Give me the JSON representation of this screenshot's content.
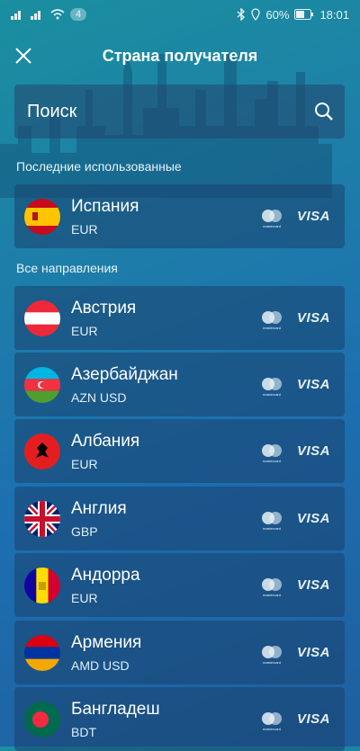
{
  "statusbar": {
    "notif_count": "4",
    "battery": "60%",
    "time": "18:01"
  },
  "header": {
    "title": "Страна получателя"
  },
  "search": {
    "placeholder": "Поиск"
  },
  "sections": {
    "recent": "Последние использованные",
    "all": "Все направления"
  },
  "card_labels": {
    "mastercard": "mastercard",
    "visa": "VISA"
  },
  "recent": [
    {
      "name": "Испания",
      "currency": "EUR",
      "flag": "spain-flag-icon"
    }
  ],
  "countries": [
    {
      "name": "Австрия",
      "currency": "EUR",
      "flag": "austria-flag-icon"
    },
    {
      "name": "Азербайджан",
      "currency": "AZN USD",
      "flag": "azerbaijan-flag-icon"
    },
    {
      "name": "Албания",
      "currency": "EUR",
      "flag": "albania-flag-icon"
    },
    {
      "name": "Англия",
      "currency": "GBP",
      "flag": "england-flag-icon"
    },
    {
      "name": "Андорра",
      "currency": "EUR",
      "flag": "andorra-flag-icon"
    },
    {
      "name": "Армения",
      "currency": "AMD USD",
      "flag": "armenia-flag-icon"
    },
    {
      "name": "Бангладеш",
      "currency": "BDT",
      "flag": "bangladesh-flag-icon"
    }
  ],
  "colors": {
    "accent": "#1d6fb0",
    "row_bg": "#19416e"
  }
}
